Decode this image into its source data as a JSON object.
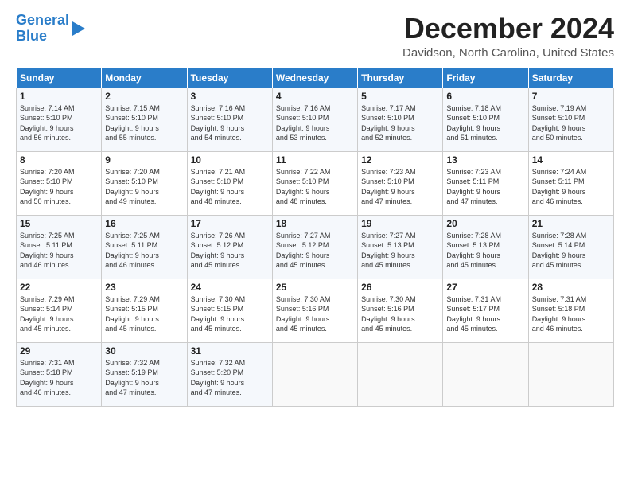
{
  "header": {
    "logo_line1": "General",
    "logo_line2": "Blue",
    "month": "December 2024",
    "location": "Davidson, North Carolina, United States"
  },
  "days_of_week": [
    "Sunday",
    "Monday",
    "Tuesday",
    "Wednesday",
    "Thursday",
    "Friday",
    "Saturday"
  ],
  "weeks": [
    [
      {
        "day": "1",
        "lines": [
          "Sunrise: 7:14 AM",
          "Sunset: 5:10 PM",
          "Daylight: 9 hours",
          "and 56 minutes."
        ]
      },
      {
        "day": "2",
        "lines": [
          "Sunrise: 7:15 AM",
          "Sunset: 5:10 PM",
          "Daylight: 9 hours",
          "and 55 minutes."
        ]
      },
      {
        "day": "3",
        "lines": [
          "Sunrise: 7:16 AM",
          "Sunset: 5:10 PM",
          "Daylight: 9 hours",
          "and 54 minutes."
        ]
      },
      {
        "day": "4",
        "lines": [
          "Sunrise: 7:16 AM",
          "Sunset: 5:10 PM",
          "Daylight: 9 hours",
          "and 53 minutes."
        ]
      },
      {
        "day": "5",
        "lines": [
          "Sunrise: 7:17 AM",
          "Sunset: 5:10 PM",
          "Daylight: 9 hours",
          "and 52 minutes."
        ]
      },
      {
        "day": "6",
        "lines": [
          "Sunrise: 7:18 AM",
          "Sunset: 5:10 PM",
          "Daylight: 9 hours",
          "and 51 minutes."
        ]
      },
      {
        "day": "7",
        "lines": [
          "Sunrise: 7:19 AM",
          "Sunset: 5:10 PM",
          "Daylight: 9 hours",
          "and 50 minutes."
        ]
      }
    ],
    [
      {
        "day": "8",
        "lines": [
          "Sunrise: 7:20 AM",
          "Sunset: 5:10 PM",
          "Daylight: 9 hours",
          "and 50 minutes."
        ]
      },
      {
        "day": "9",
        "lines": [
          "Sunrise: 7:20 AM",
          "Sunset: 5:10 PM",
          "Daylight: 9 hours",
          "and 49 minutes."
        ]
      },
      {
        "day": "10",
        "lines": [
          "Sunrise: 7:21 AM",
          "Sunset: 5:10 PM",
          "Daylight: 9 hours",
          "and 48 minutes."
        ]
      },
      {
        "day": "11",
        "lines": [
          "Sunrise: 7:22 AM",
          "Sunset: 5:10 PM",
          "Daylight: 9 hours",
          "and 48 minutes."
        ]
      },
      {
        "day": "12",
        "lines": [
          "Sunrise: 7:23 AM",
          "Sunset: 5:10 PM",
          "Daylight: 9 hours",
          "and 47 minutes."
        ]
      },
      {
        "day": "13",
        "lines": [
          "Sunrise: 7:23 AM",
          "Sunset: 5:11 PM",
          "Daylight: 9 hours",
          "and 47 minutes."
        ]
      },
      {
        "day": "14",
        "lines": [
          "Sunrise: 7:24 AM",
          "Sunset: 5:11 PM",
          "Daylight: 9 hours",
          "and 46 minutes."
        ]
      }
    ],
    [
      {
        "day": "15",
        "lines": [
          "Sunrise: 7:25 AM",
          "Sunset: 5:11 PM",
          "Daylight: 9 hours",
          "and 46 minutes."
        ]
      },
      {
        "day": "16",
        "lines": [
          "Sunrise: 7:25 AM",
          "Sunset: 5:11 PM",
          "Daylight: 9 hours",
          "and 46 minutes."
        ]
      },
      {
        "day": "17",
        "lines": [
          "Sunrise: 7:26 AM",
          "Sunset: 5:12 PM",
          "Daylight: 9 hours",
          "and 45 minutes."
        ]
      },
      {
        "day": "18",
        "lines": [
          "Sunrise: 7:27 AM",
          "Sunset: 5:12 PM",
          "Daylight: 9 hours",
          "and 45 minutes."
        ]
      },
      {
        "day": "19",
        "lines": [
          "Sunrise: 7:27 AM",
          "Sunset: 5:13 PM",
          "Daylight: 9 hours",
          "and 45 minutes."
        ]
      },
      {
        "day": "20",
        "lines": [
          "Sunrise: 7:28 AM",
          "Sunset: 5:13 PM",
          "Daylight: 9 hours",
          "and 45 minutes."
        ]
      },
      {
        "day": "21",
        "lines": [
          "Sunrise: 7:28 AM",
          "Sunset: 5:14 PM",
          "Daylight: 9 hours",
          "and 45 minutes."
        ]
      }
    ],
    [
      {
        "day": "22",
        "lines": [
          "Sunrise: 7:29 AM",
          "Sunset: 5:14 PM",
          "Daylight: 9 hours",
          "and 45 minutes."
        ]
      },
      {
        "day": "23",
        "lines": [
          "Sunrise: 7:29 AM",
          "Sunset: 5:15 PM",
          "Daylight: 9 hours",
          "and 45 minutes."
        ]
      },
      {
        "day": "24",
        "lines": [
          "Sunrise: 7:30 AM",
          "Sunset: 5:15 PM",
          "Daylight: 9 hours",
          "and 45 minutes."
        ]
      },
      {
        "day": "25",
        "lines": [
          "Sunrise: 7:30 AM",
          "Sunset: 5:16 PM",
          "Daylight: 9 hours",
          "and 45 minutes."
        ]
      },
      {
        "day": "26",
        "lines": [
          "Sunrise: 7:30 AM",
          "Sunset: 5:16 PM",
          "Daylight: 9 hours",
          "and 45 minutes."
        ]
      },
      {
        "day": "27",
        "lines": [
          "Sunrise: 7:31 AM",
          "Sunset: 5:17 PM",
          "Daylight: 9 hours",
          "and 45 minutes."
        ]
      },
      {
        "day": "28",
        "lines": [
          "Sunrise: 7:31 AM",
          "Sunset: 5:18 PM",
          "Daylight: 9 hours",
          "and 46 minutes."
        ]
      }
    ],
    [
      {
        "day": "29",
        "lines": [
          "Sunrise: 7:31 AM",
          "Sunset: 5:18 PM",
          "Daylight: 9 hours",
          "and 46 minutes."
        ]
      },
      {
        "day": "30",
        "lines": [
          "Sunrise: 7:32 AM",
          "Sunset: 5:19 PM",
          "Daylight: 9 hours",
          "and 47 minutes."
        ]
      },
      {
        "day": "31",
        "lines": [
          "Sunrise: 7:32 AM",
          "Sunset: 5:20 PM",
          "Daylight: 9 hours",
          "and 47 minutes."
        ]
      },
      {
        "day": "",
        "lines": []
      },
      {
        "day": "",
        "lines": []
      },
      {
        "day": "",
        "lines": []
      },
      {
        "day": "",
        "lines": []
      }
    ]
  ]
}
